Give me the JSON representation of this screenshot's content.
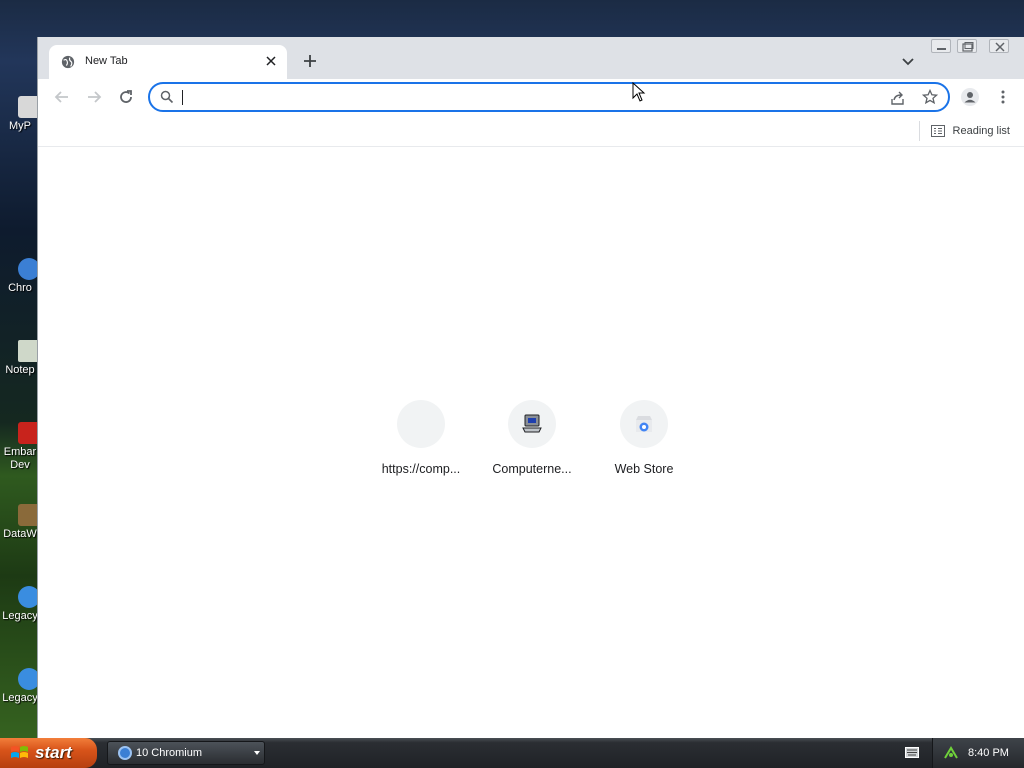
{
  "desktop": {
    "icons": [
      {
        "label": "MyP",
        "color": "#d8d8d8"
      },
      {
        "label": "Chro",
        "color": "#3b7fd4"
      },
      {
        "label": "Notep",
        "color": "#cfd8c9"
      },
      {
        "label": "Embar\nDev",
        "color": "#c8231c"
      },
      {
        "label": "DataW",
        "color": "#8a6a3a"
      },
      {
        "label": "Legacy",
        "color": "#3a8de0"
      },
      {
        "label": "Legacy",
        "color": "#3a8de0"
      }
    ]
  },
  "browser": {
    "tab": {
      "title": "New Tab",
      "close_icon": "close-icon"
    },
    "new_tab_icon": "plus-icon",
    "tab_search_icon": "chevron-down-icon",
    "window_controls": [
      "minimize-icon",
      "restore-icon",
      "close-icon"
    ],
    "toolbar": {
      "back_icon": "arrow-left-icon",
      "forward_icon": "arrow-right-icon",
      "reload_icon": "reload-icon",
      "omnibox": {
        "value": "",
        "placeholder": ""
      },
      "share_icon": "share-icon",
      "bookmark_icon": "star-icon",
      "profile_icon": "profile-icon",
      "menu_icon": "kebab-menu-icon"
    },
    "bookmark_bar": {
      "reading_list_label": "Reading list"
    },
    "shortcuts": [
      {
        "label": "https://comp...",
        "icon": "blank-favicon"
      },
      {
        "label": "Computerne...",
        "icon": "computer-favicon"
      },
      {
        "label": "Web Store",
        "icon": "web-store-favicon"
      }
    ]
  },
  "taskbar": {
    "start_label": "start",
    "task_button_label": "10 Chromium",
    "clock": "8:40 PM"
  },
  "colors": {
    "accent": "#1a73e8",
    "tabstrip": "#dee1e6",
    "start": "#d8541a"
  }
}
